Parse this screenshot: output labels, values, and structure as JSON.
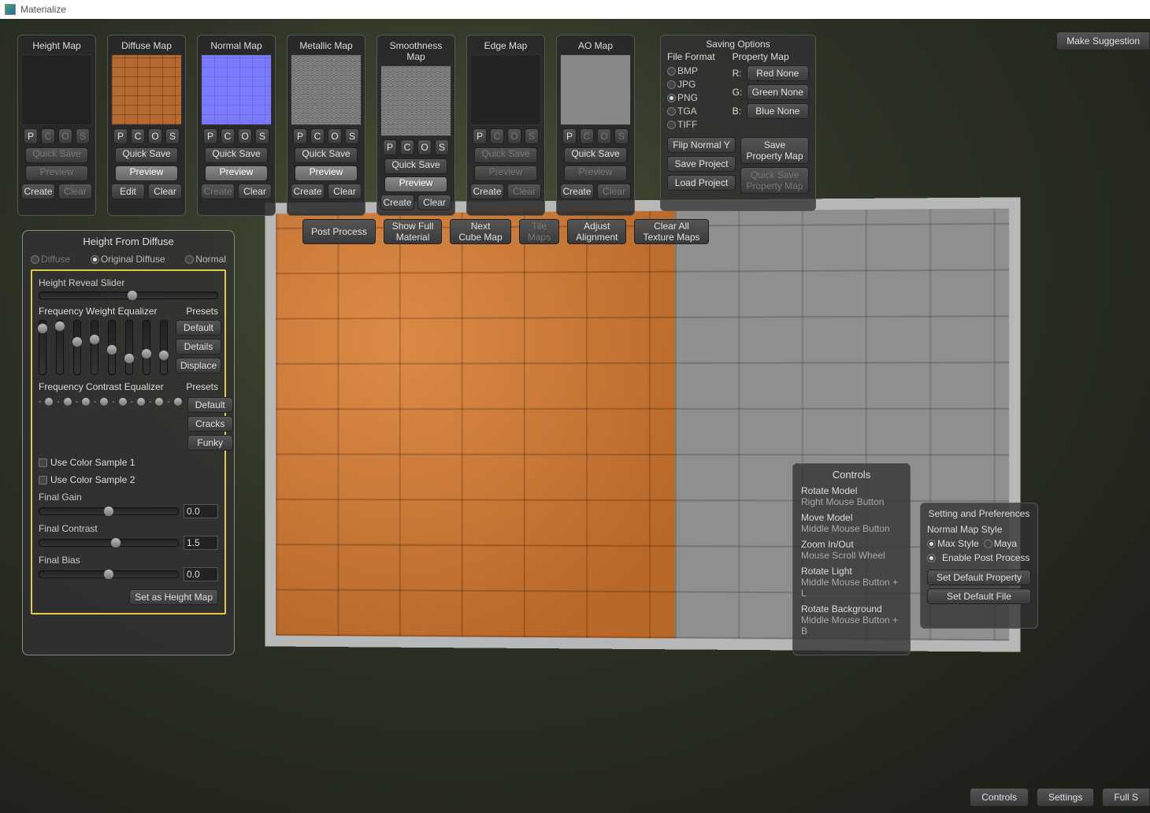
{
  "app": {
    "title": "Materialize"
  },
  "maps": [
    {
      "key": "height",
      "title": "Height Map",
      "thumb": "empty",
      "pcos_dim": [
        false,
        true,
        true,
        true
      ],
      "quicksave_dim": true,
      "preview_dim": true,
      "bl": "Create",
      "bl_dim": false,
      "br": "Clear",
      "br_dim": true
    },
    {
      "key": "diffuse",
      "title": "Diffuse Map",
      "thumb": "diffuse",
      "pcos_dim": [
        false,
        false,
        false,
        false
      ],
      "quicksave_dim": false,
      "preview_dim": false,
      "preview_light": true,
      "bl": "Edit",
      "bl_dim": false,
      "br": "Clear",
      "br_dim": false
    },
    {
      "key": "normal",
      "title": "Normal Map",
      "thumb": "normal",
      "pcos_dim": [
        false,
        false,
        false,
        false
      ],
      "quicksave_dim": false,
      "preview_dim": false,
      "preview_light": true,
      "bl": "Create",
      "bl_dim": true,
      "br": "Clear",
      "br_dim": false
    },
    {
      "key": "metallic",
      "title": "Metallic Map",
      "thumb": "noise",
      "pcos_dim": [
        false,
        false,
        false,
        false
      ],
      "quicksave_dim": false,
      "preview_dim": false,
      "preview_light": true,
      "bl": "Create",
      "bl_dim": false,
      "br": "Clear",
      "br_dim": false
    },
    {
      "key": "smoothness",
      "title": "Smoothness Map",
      "thumb": "noise",
      "pcos_dim": [
        false,
        false,
        false,
        false
      ],
      "quicksave_dim": false,
      "preview_dim": false,
      "preview_light": true,
      "bl": "Create",
      "bl_dim": false,
      "br": "Clear",
      "br_dim": false
    },
    {
      "key": "edge",
      "title": "Edge Map",
      "thumb": "empty",
      "pcos_dim": [
        false,
        true,
        true,
        true
      ],
      "quicksave_dim": true,
      "preview_dim": true,
      "bl": "Create",
      "bl_dim": false,
      "br": "Clear",
      "br_dim": true
    },
    {
      "key": "ao",
      "title": "AO Map",
      "thumb": "grey",
      "pcos_dim": [
        false,
        true,
        true,
        true
      ],
      "quicksave_dim": false,
      "preview_dim": true,
      "bl": "Create",
      "bl_dim": false,
      "br": "Clear",
      "br_dim": true
    }
  ],
  "pcos_labels": [
    "P",
    "C",
    "O",
    "S"
  ],
  "map_buttons": {
    "quicksave": "Quick Save",
    "preview": "Preview"
  },
  "saving": {
    "header": "Saving Options",
    "file_format_label": "File Format",
    "property_map_label": "Property Map",
    "formats": [
      {
        "label": "BMP",
        "on": false
      },
      {
        "label": "JPG",
        "on": false
      },
      {
        "label": "PNG",
        "on": true
      },
      {
        "label": "TGA",
        "on": false
      },
      {
        "label": "TIFF",
        "on": false
      }
    ],
    "channels": [
      {
        "ch": "R:",
        "val": "Red None"
      },
      {
        "ch": "G:",
        "val": "Green None"
      },
      {
        "ch": "B:",
        "val": "Blue None"
      }
    ],
    "flip": "Flip Normal Y",
    "save_project": "Save Project",
    "load_project": "Load Project",
    "save_pm1": "Save",
    "save_pm2": "Property Map",
    "qs_pm1": "Quick Save",
    "qs_pm2": "Property Map"
  },
  "actions": {
    "post_process": "Post Process",
    "show_full1": "Show Full",
    "show_full2": "Material",
    "next_cube1": "Next",
    "next_cube2": "Cube Map",
    "tile1": "Tile",
    "tile2": "Maps",
    "adjust1": "Adjust",
    "adjust2": "Alignment",
    "clear1": "Clear All",
    "clear2": "Texture Maps"
  },
  "hfd": {
    "title": "Height From Diffuse",
    "src": {
      "diffuse": "Diffuse",
      "original": "Original Diffuse",
      "normal": "Normal",
      "selected": "original"
    },
    "height_reveal": "Height Reveal Slider",
    "fwe": "Frequency Weight Equalizer",
    "fce": "Frequency Contrast Equalizer",
    "presets_label": "Presets",
    "fwe_presets": [
      "Default",
      "Details",
      "Displace"
    ],
    "fce_presets": [
      "Default",
      "Cracks",
      "Funky"
    ],
    "color1": "Use Color Sample 1",
    "color2": "Use Color Sample 2",
    "final_gain": "Final Gain",
    "final_gain_val": "0.0",
    "final_contrast": "Final Contrast",
    "final_contrast_val": "1.5",
    "final_bias": "Final Bias",
    "final_bias_val": "0.0",
    "set_btn": "Set as Height Map",
    "fwe_values_pct": [
      15,
      10,
      40,
      35,
      55,
      70,
      62,
      65
    ],
    "reveal_pos_pct": 52,
    "gain_pos_pct": 50,
    "contrast_pos_pct": 55,
    "bias_pos_pct": 50
  },
  "controls": {
    "title": "Controls",
    "items": [
      {
        "act": "Rotate Model",
        "how": "Right Mouse Button"
      },
      {
        "act": "Move Model",
        "how": "Middle Mouse Button"
      },
      {
        "act": "Zoom In/Out",
        "how": "Mouse Scroll Wheel"
      },
      {
        "act": "Rotate Light",
        "how": "Middle Mouse Button + L"
      },
      {
        "act": "Rotate Background",
        "how": "Middle Mouse Button + B"
      }
    ]
  },
  "settings": {
    "title": "Setting and Preferences",
    "nm_style": "Normal Map Style",
    "max": "Max Style",
    "maya": "Maya",
    "epp": "Enable Post Process",
    "set_prop": "Set Default Property",
    "set_file": "Set Default File"
  },
  "suggestion": "Make Suggestion",
  "bottom": {
    "controls": "Controls",
    "settings": "Settings",
    "full": "Full S"
  }
}
